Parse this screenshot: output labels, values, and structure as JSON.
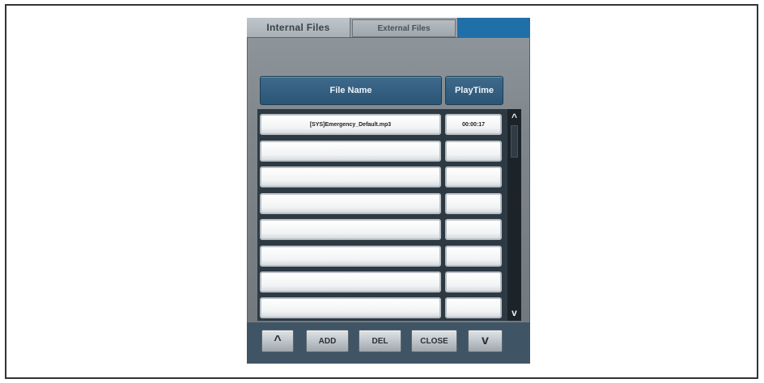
{
  "tabs": {
    "internal": "Internal Files",
    "external": "External Files"
  },
  "table": {
    "columns": {
      "file_name": "File Name",
      "play_time": "PlayTime"
    },
    "rows": [
      {
        "file_name": "[SYS]Emergency_Default.mp3",
        "play_time": "00:00:17"
      },
      {
        "file_name": "",
        "play_time": ""
      },
      {
        "file_name": "",
        "play_time": ""
      },
      {
        "file_name": "",
        "play_time": ""
      },
      {
        "file_name": "",
        "play_time": ""
      },
      {
        "file_name": "",
        "play_time": ""
      },
      {
        "file_name": "",
        "play_time": ""
      },
      {
        "file_name": "",
        "play_time": ""
      }
    ]
  },
  "scrollbar": {
    "up_glyph": "^",
    "down_glyph": "v"
  },
  "buttons": {
    "up": "^",
    "add": "ADD",
    "del": "DEL",
    "close": "CLOSE",
    "down": "v"
  },
  "colors": {
    "header_bg": "#2c5575",
    "tab_accent": "#1f6fa8",
    "panel_bg": "#7e868c"
  }
}
